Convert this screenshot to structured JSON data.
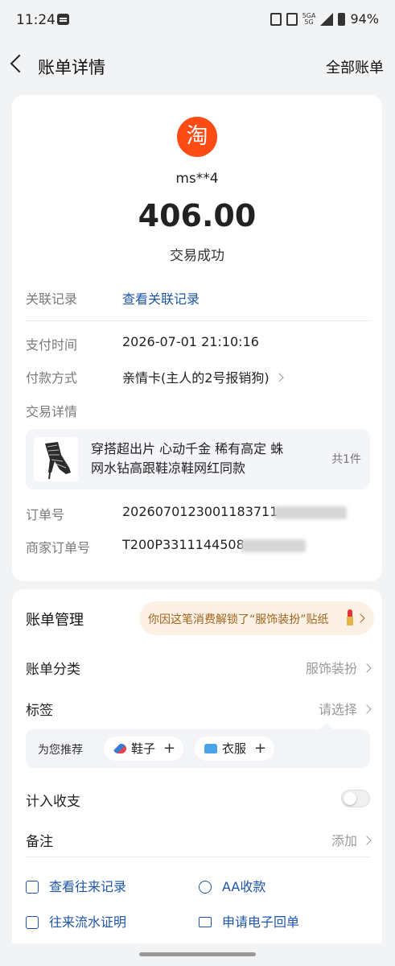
{
  "status_bar": {
    "time": "11:24",
    "network_top": "5GA",
    "network_bottom": "5G",
    "battery": "94%"
  },
  "nav": {
    "title": "账单详情",
    "right_action": "全部账单"
  },
  "summary": {
    "logo_char": "淘",
    "merchant": "ms**4",
    "amount": "406.00",
    "status": "交易成功"
  },
  "details": {
    "related_label": "关联记录",
    "related_value": "查看关联记录",
    "pay_time_label": "支付时间",
    "pay_time_value": "2026-07-01 21:10:16",
    "pay_method_label": "付款方式",
    "pay_method_value": "亲情卡(主人的2号报销狗)",
    "trade_detail_label": "交易详情",
    "product_name": "穿搭超出片 心动千金 稀有高定 蛛网水钻高跟鞋凉鞋网红同款",
    "product_count": "共1件",
    "order_no_label": "订单号",
    "order_no_value": "2026070123001183711",
    "merchant_order_label": "商家订单号",
    "merchant_order_value": "T200P3311144508"
  },
  "management": {
    "title": "账单管理",
    "sticker_text": "你因这笔消费解锁了“服饰装扮”贴纸",
    "category_label": "账单分类",
    "category_value": "服饰装扮",
    "tag_label": "标签",
    "tag_value": "请选择",
    "recommend_label": "为您推荐",
    "chips": [
      "鞋子",
      "衣服"
    ],
    "income_label": "计入收支",
    "note_label": "备注",
    "note_value": "添加"
  },
  "actions": [
    {
      "label": "查看往来记录",
      "icon": "search-record-icon"
    },
    {
      "label": "AA收款",
      "icon": "aa-icon"
    },
    {
      "label": "往来流水证明",
      "icon": "document-icon"
    },
    {
      "label": "申请电子回单",
      "icon": "mail-icon"
    }
  ]
}
